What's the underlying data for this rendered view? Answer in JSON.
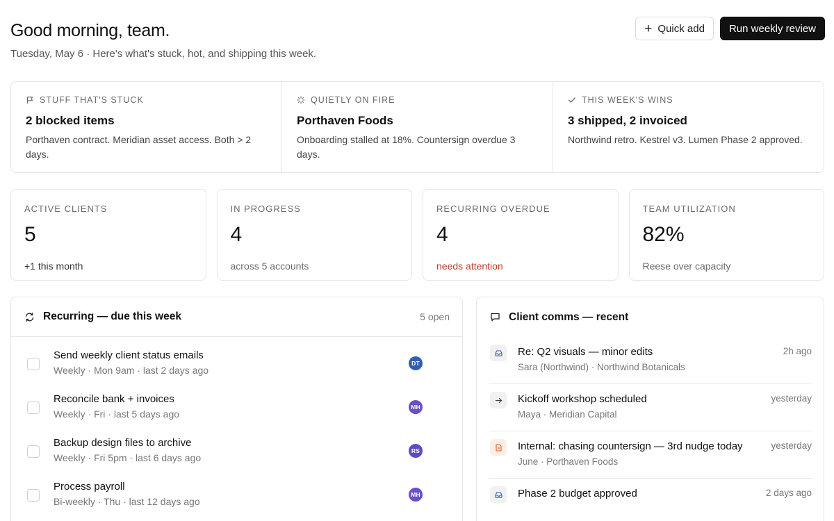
{
  "header": {
    "greeting": "Good morning, team.",
    "subtitle": "Tuesday, May 6 · Here's what's stuck, hot, and shipping this week.",
    "quick_add_label": "Quick add",
    "run_review_label": "Run weekly review"
  },
  "pulse": [
    {
      "kicker": "STUFF THAT'S STUCK",
      "icon": "flag-icon",
      "title": "2 blocked items",
      "desc": "Porthaven contract. Meridian asset access. Both > 2 days."
    },
    {
      "kicker": "QUIETLY ON FIRE",
      "icon": "spinner-icon",
      "title": "Porthaven Foods",
      "desc": "Onboarding stalled at 18%. Countersign overdue 3 days."
    },
    {
      "kicker": "THIS WEEK'S WINS",
      "icon": "check-icon",
      "title": "3 shipped, 2 invoiced",
      "desc": "Northwind retro. Kestrel v3. Lumen Phase 2 approved."
    }
  ],
  "stats": [
    {
      "label": "ACTIVE CLIENTS",
      "value": "5",
      "note": "+1 this month"
    },
    {
      "label": "IN PROGRESS",
      "value": "4",
      "note": "across 5 accounts"
    },
    {
      "label": "RECURRING OVERDUE",
      "value": "4",
      "note": "needs attention"
    },
    {
      "label": "TEAM UTILIZATION",
      "value": "82%",
      "note": "Reese over capacity"
    }
  ],
  "recurring": {
    "title": "Recurring — due this week",
    "count": "5 open",
    "items": [
      {
        "title": "Send weekly client status emails",
        "meta": "Weekly · Mon 9am · last 2 days ago",
        "assignee": "DT"
      },
      {
        "title": "Reconcile bank + invoices",
        "meta": "Weekly · Fri · last 5 days ago",
        "assignee": "MH"
      },
      {
        "title": "Backup design files to archive",
        "meta": "Weekly · Fri 5pm · last 6 days ago",
        "assignee": "RS"
      },
      {
        "title": "Process payroll",
        "meta": "Bi-weekly · Thu · last 12 days ago",
        "assignee": "MH"
      }
    ]
  },
  "comms": {
    "title": "Client comms — recent",
    "items": [
      {
        "title": "Re: Q2 visuals — minor edits",
        "meta": "Sara (Northwind) · Northwind Botanicals",
        "time": "2h ago",
        "icon": "inbox-icon"
      },
      {
        "title": "Kickoff workshop scheduled",
        "meta": "Maya · Meridian Capital",
        "time": "yesterday",
        "icon": "arrow-right-icon"
      },
      {
        "title": "Internal: chasing countersign — 3rd nudge today",
        "meta": "June · Porthaven Foods",
        "time": "yesterday",
        "icon": "document-icon"
      },
      {
        "title": "Phase 2 budget approved",
        "meta": "",
        "time": "2 days ago",
        "icon": "inbox-icon"
      }
    ]
  },
  "colors": {
    "accent_dark": "#111111",
    "alert": "#c0392b",
    "avatar_dt": "#2f5fb3",
    "avatar_mh": "#6a4fc8",
    "avatar_rs": "#5b4bc4",
    "doc_icon_bg": "#fdeee3"
  }
}
